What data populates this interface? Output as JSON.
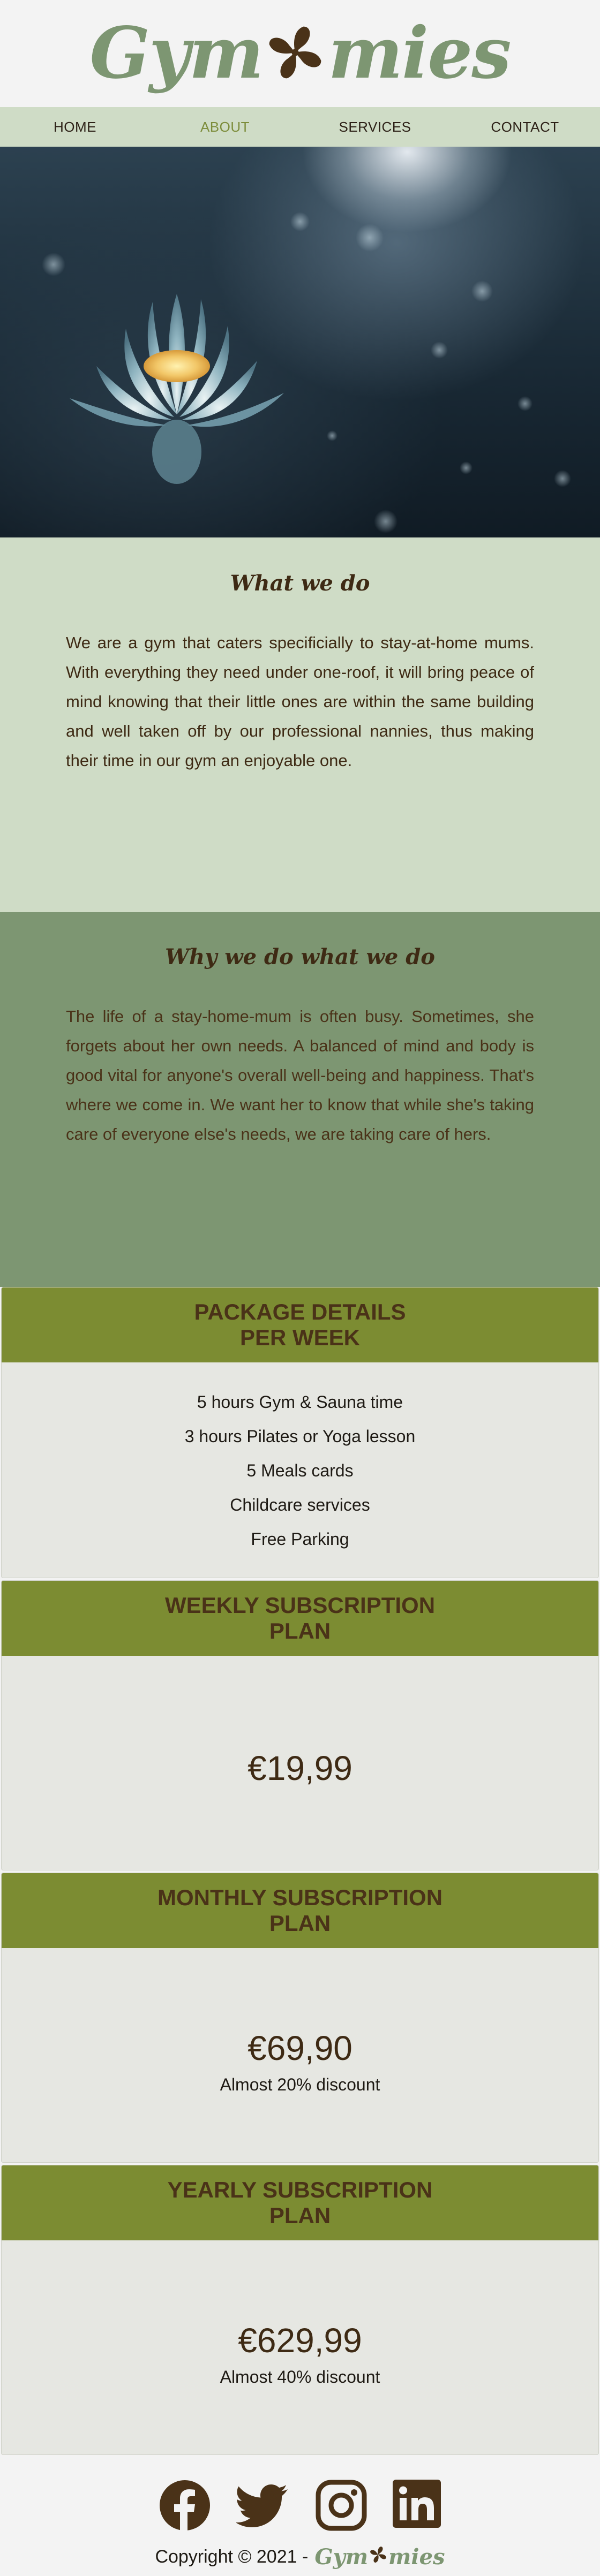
{
  "brand": {
    "name_left": "Gym",
    "name_right": "mies"
  },
  "nav": {
    "items": [
      {
        "label": "HOME"
      },
      {
        "label": "ABOUT"
      },
      {
        "label": "SERVICES"
      },
      {
        "label": "CONTACT"
      }
    ],
    "active": "ABOUT"
  },
  "hero": {
    "image": "lotus-flower"
  },
  "what_we_do": {
    "title": "What we do",
    "body": "We are a gym that caters specificially to stay-at-home mums. With everything they need under one-roof, it will bring peace of mind knowing that their little ones are within the same building and well taken off by our professional nannies, thus making their time in our gym an enjoyable one."
  },
  "why": {
    "title": "Why we do what we do",
    "body": "The life of a stay-home-mum is often busy. Sometimes, she forgets about her own needs. A balanced of mind and body is good vital for anyone's overall well-being and happiness. That's where we come in. We want her to know that while she's taking care of everyone else's needs, we are taking care of hers."
  },
  "package": {
    "title_line1": "PACKAGE DETAILS",
    "title_line2": "PER WEEK",
    "items": [
      "5 hours Gym & Sauna time",
      "3 hours Pilates or Yoga lesson",
      "5 Meals cards",
      "Childcare services",
      "Free Parking"
    ]
  },
  "plans": [
    {
      "title_line1": "WEEKLY SUBSCRIPTION",
      "title_line2": "PLAN",
      "price": "€19,99",
      "note": ""
    },
    {
      "title_line1": "MONTHLY SUBSCRIPTION",
      "title_line2": "PLAN",
      "price": "€69,90",
      "note": "Almost 20% discount"
    },
    {
      "title_line1": "YEARLY SUBSCRIPTION",
      "title_line2": "PLAN",
      "price": "€629,99",
      "note": "Almost 40% discount"
    }
  ],
  "footer": {
    "social": [
      "facebook-icon",
      "twitter-icon",
      "instagram-icon",
      "linkedin-icon"
    ],
    "copyright": "Copyright © 2021 -"
  },
  "colors": {
    "logo_green": "#7d9672",
    "brown": "#4a3218",
    "sage_light": "#cfdcc6",
    "sage_dark": "#7d9672",
    "olive": "#7c8c32",
    "nav_active": "#7c8c3a"
  }
}
